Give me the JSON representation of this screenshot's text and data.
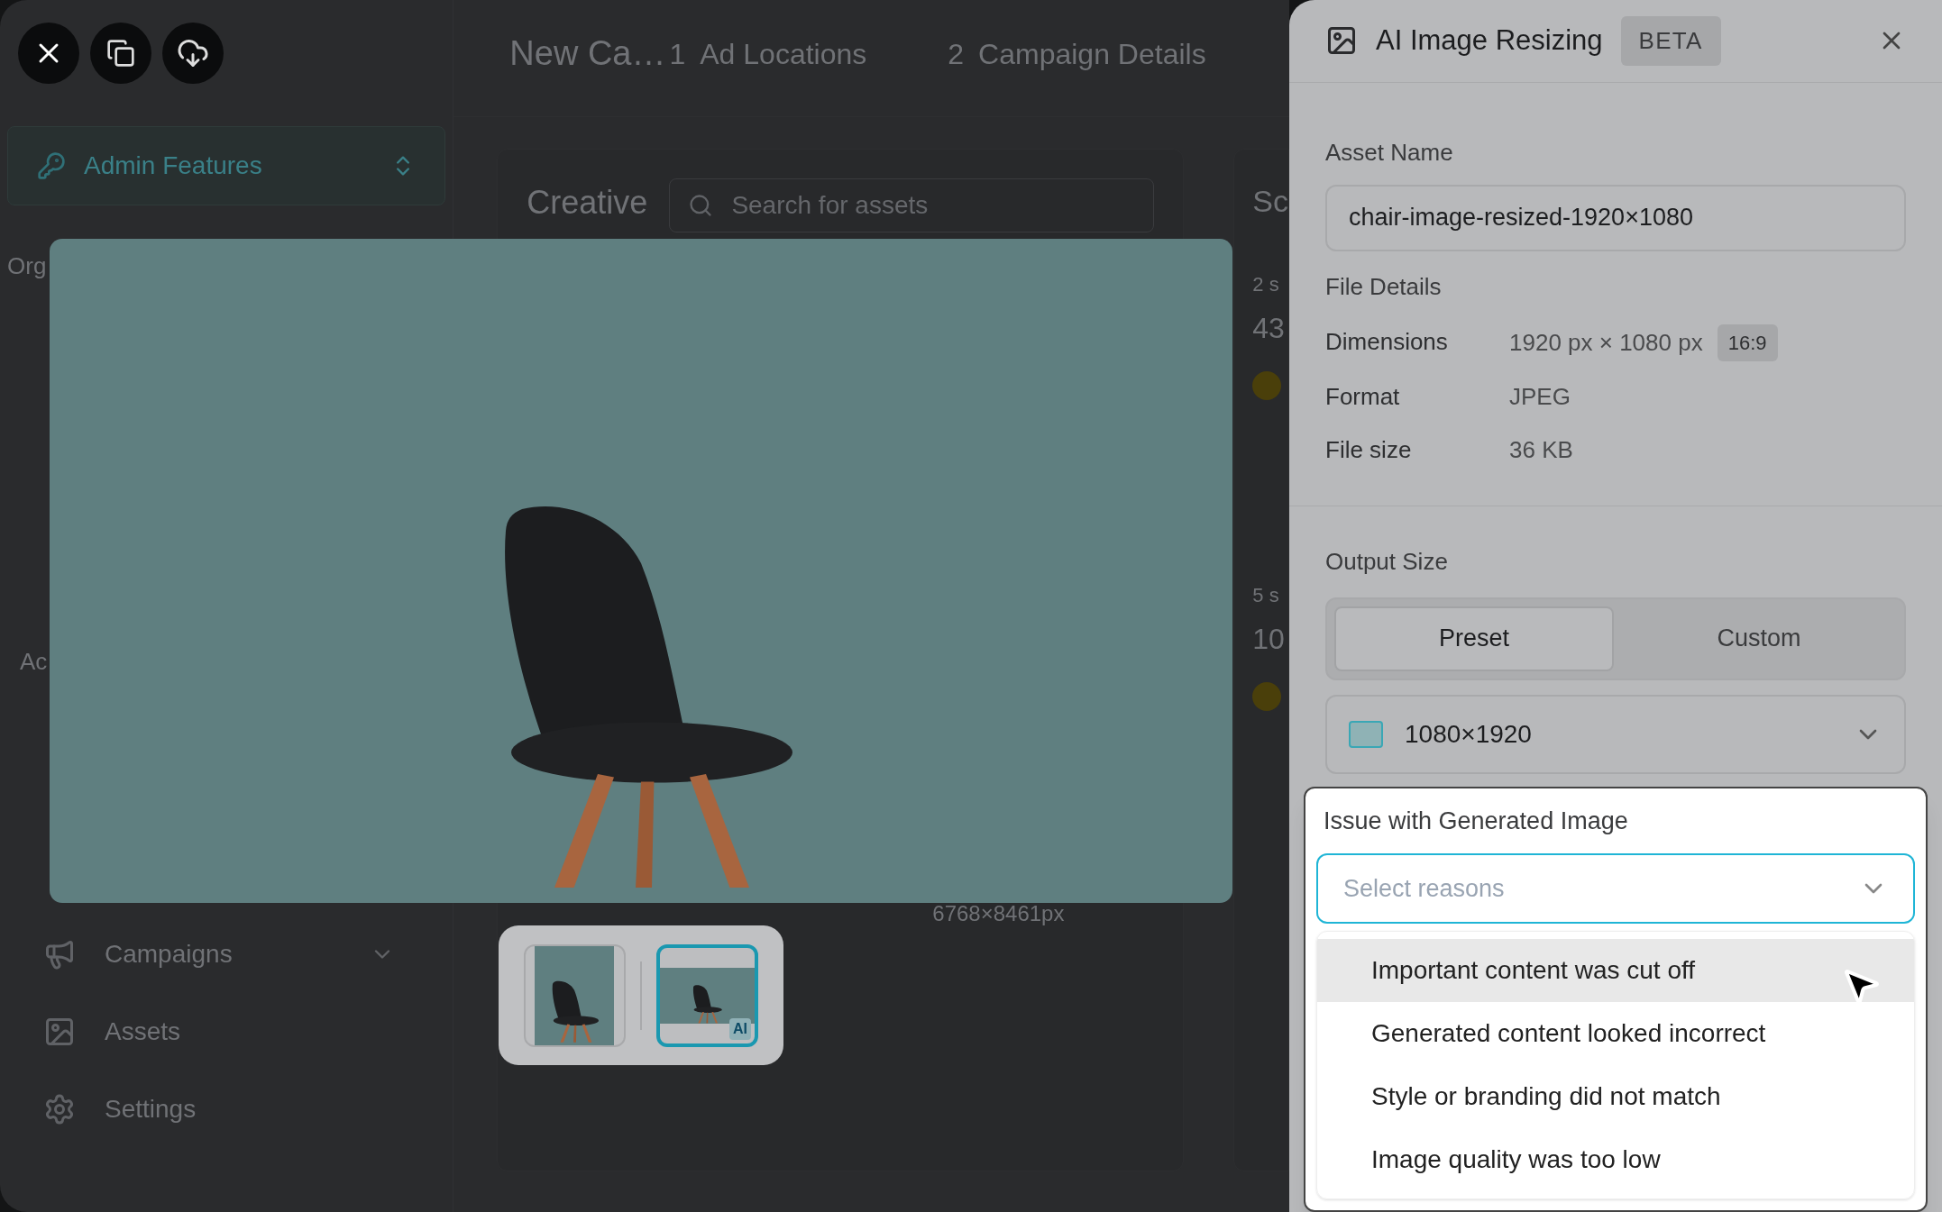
{
  "header": {
    "title": "New Ca…",
    "steps": [
      {
        "number": "1",
        "label": "Ad Locations"
      },
      {
        "number": "2",
        "label": "Campaign Details"
      }
    ]
  },
  "sidebar": {
    "switcher": "Admin Features",
    "org_label": "Org",
    "section_label": "Ac",
    "nav_items": [
      {
        "label": "Campaigns",
        "expandable": true
      },
      {
        "label": "Assets",
        "expandable": false
      },
      {
        "label": "Settings",
        "expandable": false
      }
    ]
  },
  "library": {
    "title": "Creative",
    "search_placeholder": "Search for assets",
    "asset_size": "6768×8461px"
  },
  "schedule": {
    "heading": "Sc",
    "cards": [
      {
        "tag": "2 s",
        "value": "43"
      },
      {
        "tag": "5 s",
        "value": "10"
      }
    ]
  },
  "preview": {
    "thumbnails": [
      {
        "kind": "original",
        "selected": false
      },
      {
        "kind": "ai",
        "badge": "AI",
        "selected": true
      }
    ]
  },
  "panel": {
    "title": "AI Image Resizing",
    "badge": "BETA",
    "asset_name": {
      "label": "Asset Name",
      "value": "chair-image-resized-1920×1080"
    },
    "file_details": {
      "heading": "File Details",
      "rows": [
        {
          "label": "Dimensions",
          "value": "1920 px × 1080 px",
          "tag": "16:9"
        },
        {
          "label": "Format",
          "value": "JPEG"
        },
        {
          "label": "File size",
          "value": "36 KB"
        }
      ]
    },
    "output_size": {
      "label": "Output Size",
      "modes": [
        {
          "label": "Preset",
          "selected": true
        },
        {
          "label": "Custom",
          "selected": false
        }
      ],
      "size": "1080×1920"
    },
    "issue": {
      "label": "Issue with Generated Image",
      "placeholder": "Select reasons",
      "options": [
        {
          "label": "Important content was cut off",
          "highlighted": true
        },
        {
          "label": "Generated content looked incorrect",
          "highlighted": false
        },
        {
          "label": "Style or branding did not match",
          "highlighted": false
        },
        {
          "label": "Image quality was too low",
          "highlighted": false
        }
      ]
    }
  }
}
